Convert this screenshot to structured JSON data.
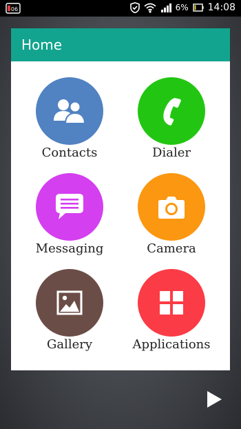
{
  "status_bar": {
    "notification_label": "06",
    "battery_percent": "6%",
    "time": "14:08"
  },
  "header": {
    "title": "Home"
  },
  "tiles": [
    {
      "label": "Contacts",
      "color": "#5182c2",
      "icon": "contacts-icon"
    },
    {
      "label": "Dialer",
      "color": "#22c612",
      "icon": "phone-icon"
    },
    {
      "label": "Messaging",
      "color": "#d43ff0",
      "icon": "message-icon"
    },
    {
      "label": "Camera",
      "color": "#fb9710",
      "icon": "camera-icon"
    },
    {
      "label": "Gallery",
      "color": "#6b4d47",
      "icon": "image-icon"
    },
    {
      "label": "Applications",
      "color": "#fb3b45",
      "icon": "grid-icon"
    }
  ],
  "colors": {
    "header": "#12a48e",
    "status_bar": "#000000"
  }
}
